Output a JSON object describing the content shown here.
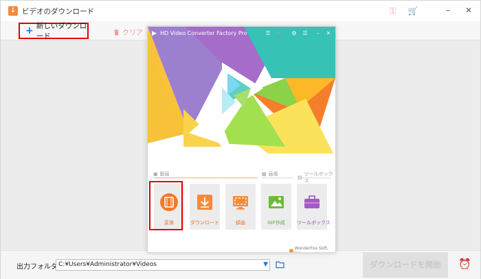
{
  "window": {
    "title": "ビデオのダウンロード"
  },
  "toolbar": {
    "new_download_label": "新しいダウンロード",
    "clear_label": "クリア"
  },
  "bottom": {
    "output_label": "出力フォルダ：",
    "output_path": "C:¥Users¥Administrator¥Videos",
    "start_label": "ダウンロードを開始"
  },
  "inner_app": {
    "title": "HD Video Converter Factory Pro",
    "sections": {
      "video": "動画",
      "image": "画像",
      "toolbox": "ツールボックス"
    },
    "tools": [
      {
        "label": "変換",
        "icon": "film-icon"
      },
      {
        "label": "ダウンロード",
        "icon": "download-icon"
      },
      {
        "label": "録画",
        "icon": "screen-record-icon"
      },
      {
        "label": "GIF作成",
        "icon": "gif-image-icon"
      },
      {
        "label": "ツールボックス",
        "icon": "toolbox-icon"
      }
    ],
    "footer": "WonderFox Soft, Inc."
  },
  "colors": {
    "accent_orange": "#f58a3c",
    "highlight_red": "#e00000",
    "link_blue": "#1e6fd9"
  }
}
